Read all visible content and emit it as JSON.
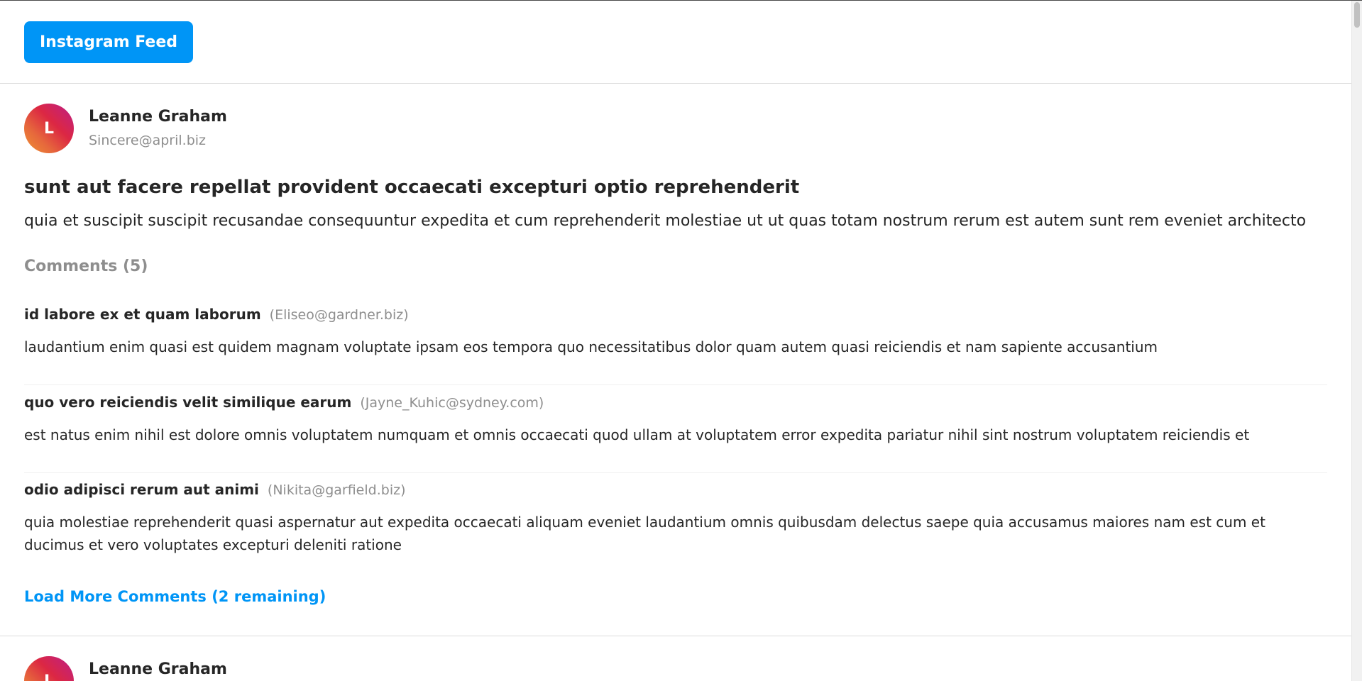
{
  "header": {
    "feed_button_label": "Instagram Feed"
  },
  "posts": [
    {
      "avatar_initial": "L",
      "user_name": "Leanne Graham",
      "user_email": "Sincere@april.biz",
      "title": "sunt aut facere repellat provident occaecati excepturi optio reprehenderit",
      "body": "quia et suscipit suscipit recusandae consequuntur expedita et cum reprehenderit molestiae ut ut quas totam nostrum rerum est autem sunt rem eveniet architecto",
      "comments_heading": "Comments (5)",
      "comments": [
        {
          "name": "id labore ex et quam laborum",
          "email": "(Eliseo@gardner.biz)",
          "body": "laudantium enim quasi est quidem magnam voluptate ipsam eos tempora quo necessitatibus dolor quam autem quasi reiciendis et nam sapiente accusantium"
        },
        {
          "name": "quo vero reiciendis velit similique earum",
          "email": "(Jayne_Kuhic@sydney.com)",
          "body": "est natus enim nihil est dolore omnis voluptatem numquam et omnis occaecati quod ullam at voluptatem error expedita pariatur nihil sint nostrum voluptatem reiciendis et"
        },
        {
          "name": "odio adipisci rerum aut animi",
          "email": "(Nikita@garfield.biz)",
          "body": "quia molestiae reprehenderit quasi aspernatur aut expedita occaecati aliquam eveniet laudantium omnis quibusdam delectus saepe quia accusamus maiores nam est cum et ducimus et vero voluptates excepturi deleniti ratione"
        }
      ],
      "load_more_label": "Load More Comments (2 remaining)"
    },
    {
      "avatar_initial": "L",
      "user_name": "Leanne Graham"
    }
  ],
  "colors": {
    "accent": "#0095f6",
    "text": "#262626",
    "muted": "#8e8e8e",
    "divider": "#dbdbdb"
  }
}
